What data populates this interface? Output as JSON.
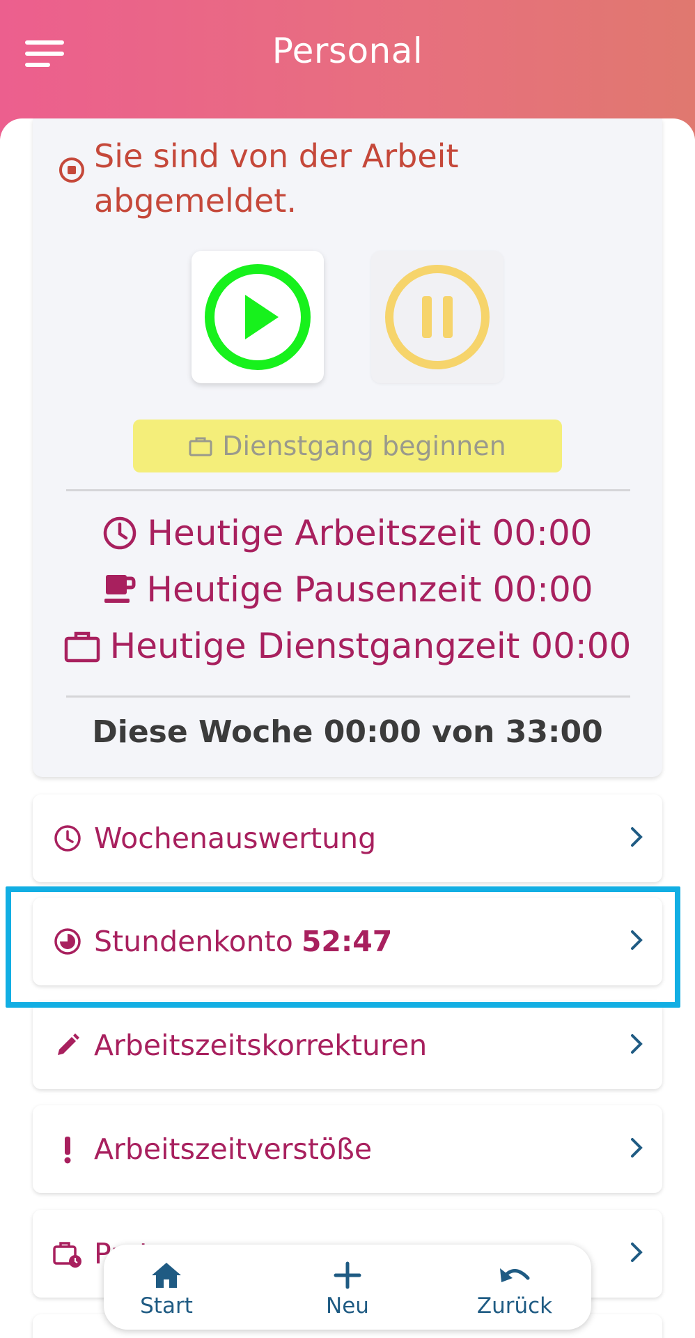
{
  "header": {
    "title": "Personal",
    "menu_icon": "menu-icon"
  },
  "status": {
    "message": "Sie sind von der Arbeit abgemeldet.",
    "color": "#c5483a",
    "icon": "stop-circle-icon"
  },
  "controls": {
    "play_icon": "play-circle-icon",
    "play_color": "#17f11c",
    "pause_icon": "pause-circle-icon",
    "pause_color": "#f6d46b",
    "dienstgang_label": "Dienstgang beginnen",
    "dienstgang_color": "#f4ee7a"
  },
  "today": {
    "work_label": "Heutige Arbeitszeit 00:00",
    "pause_label": "Heutige Pausenzeit 00:00",
    "errand_label": "Heutige Dienstgangzeit 00:00"
  },
  "week": {
    "summary": "Diese Woche 00:00 von 33:00"
  },
  "rows": [
    {
      "label": "Wochenauswertung",
      "value": "",
      "icon": "clock-icon"
    },
    {
      "label": "Stundenkonto",
      "value": "52:47",
      "icon": "pie-clock-icon"
    },
    {
      "label": "Arbeitszeitskorrekturen",
      "value": "",
      "icon": "pencil-icon"
    },
    {
      "label": "Arbeitszeitverstöße",
      "value": "",
      "icon": "exclamation-icon"
    },
    {
      "label": "Proto",
      "value": "",
      "icon": "briefcase-clock-icon"
    }
  ],
  "bottom_nav": [
    {
      "label": "Start",
      "icon": "home-icon"
    },
    {
      "label": "Neu",
      "icon": "plus-icon"
    },
    {
      "label": "Zurück",
      "icon": "undo-icon"
    }
  ],
  "accent_color": "#a8205e",
  "nav_color": "#1f5b83",
  "highlight_color": "#12aee3"
}
